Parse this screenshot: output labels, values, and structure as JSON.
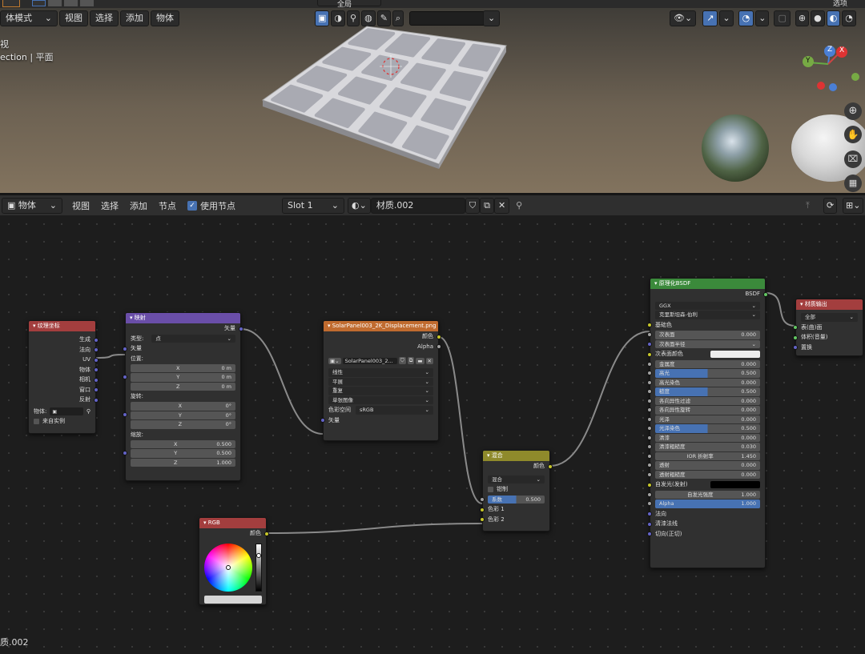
{
  "viewport": {
    "mode_label": "体模式",
    "menu": [
      "视图",
      "选择",
      "添加",
      "物体"
    ],
    "overlay_line1": "视",
    "overlay_line2": "ection | 平面",
    "top_cut_labels": [
      "全局",
      "选项"
    ],
    "gizmo": {
      "z": "Z",
      "x": "X",
      "y": "Y"
    }
  },
  "node_editor": {
    "editor_type": "物体",
    "menu": [
      "视图",
      "选择",
      "添加",
      "节点"
    ],
    "use_nodes_label": "使用节点",
    "slot": "Slot 1",
    "material_name": "材质.002",
    "footer_label": "质.002"
  },
  "nodes": {
    "texcoord": {
      "title": "纹理坐标",
      "outputs": [
        "生成",
        "法向",
        "UV",
        "物体",
        "相机",
        "窗口",
        "反射"
      ],
      "object_label": "物体:",
      "instancer_label": "来自实例"
    },
    "mapping": {
      "title": "映射",
      "out_vector": "矢量",
      "type_label": "类型:",
      "type_value": "点",
      "in_vector": "矢量",
      "location_label": "位置:",
      "location": [
        {
          "axis": "X",
          "value": "0 m"
        },
        {
          "axis": "Y",
          "value": "0 m"
        },
        {
          "axis": "Z",
          "value": "0 m"
        }
      ],
      "rotation_label": "旋转:",
      "rotation": [
        {
          "axis": "X",
          "value": "0°"
        },
        {
          "axis": "Y",
          "value": "0°"
        },
        {
          "axis": "Z",
          "value": "0°"
        }
      ],
      "scale_label": "缩放:",
      "scale": [
        {
          "axis": "X",
          "value": "0.500"
        },
        {
          "axis": "Y",
          "value": "0.500"
        },
        {
          "axis": "Z",
          "value": "1.000"
        }
      ]
    },
    "image": {
      "title": "SolarPanel003_2K_Displacement.png",
      "out_color": "颜色",
      "out_alpha": "Alpha",
      "image_name": "SolarPanel003_2...",
      "interp": "线性",
      "projection": "平展",
      "extension": "重复",
      "source": "单张图像",
      "colorspace_label": "色彩空间",
      "colorspace_value": "sRGB",
      "in_vector": "矢量"
    },
    "rgb": {
      "title": "RGB",
      "out_color": "颜色"
    },
    "mix": {
      "title": "混合",
      "out_color": "颜色",
      "blend": "混合",
      "clamp": "钳制",
      "factor_label": "系数",
      "factor_value": "0.500",
      "factor": 0.5,
      "color1": "色彩 1",
      "color2": "色彩 2"
    },
    "bsdf": {
      "title": "原理化BSDF",
      "out": "BSDF",
      "distribution": "GGX",
      "subsurface_method": "克里斯坦森-伯利",
      "base_color": "基础色",
      "subsurface": {
        "label": "次表面",
        "value": "0.000"
      },
      "subsurface_radius": "次表面半径",
      "subsurface_color": "次表面颜色",
      "params": [
        {
          "label": "金属度",
          "value": "0.000",
          "fill": 0.0
        },
        {
          "label": "高光",
          "value": "0.500",
          "fill": 0.5
        },
        {
          "label": "高光染色",
          "value": "0.000",
          "fill": 0.0
        },
        {
          "label": "糙度",
          "value": "0.500",
          "fill": 0.5
        },
        {
          "label": "各向异性过滤",
          "value": "0.000",
          "fill": 0.0
        },
        {
          "label": "各向异性旋转",
          "value": "0.000",
          "fill": 0.0
        },
        {
          "label": "光泽",
          "value": "0.000",
          "fill": 0.0
        },
        {
          "label": "光泽染色",
          "value": "0.500",
          "fill": 0.5
        },
        {
          "label": "清漆",
          "value": "0.000",
          "fill": 0.0
        },
        {
          "label": "清漆粗糙度",
          "value": "0.030",
          "fill": 0.03
        },
        {
          "label": "IOR 折射率",
          "value": "1.450",
          "fill": 0.0
        },
        {
          "label": "透射",
          "value": "0.000",
          "fill": 0.0
        },
        {
          "label": "透射粗糙度",
          "value": "0.000",
          "fill": 0.0
        }
      ],
      "emission": "自发光(发射)",
      "emission_strength": {
        "label": "自发光强度",
        "value": "1.000"
      },
      "alpha": {
        "label": "Alpha",
        "value": "1.000"
      },
      "normal": "法向",
      "clearcoat_normal": "清漆法线",
      "tangent": "切向(正切)"
    },
    "output": {
      "title": "材质输出",
      "target": "全部",
      "surface": "表(曲)面",
      "volume": "体积(音量)",
      "displacement": "置换"
    }
  },
  "colors": {
    "accent": "#4772b3",
    "texcoord_header": "#a33e3e",
    "mapping_header": "#6a4ea8",
    "image_header": "#c06b2f",
    "rgb_header": "#a33e3e",
    "mix_header": "#8f8a2b",
    "bsdf_header": "#3b8a3b",
    "output_header": "#a33e3e"
  }
}
